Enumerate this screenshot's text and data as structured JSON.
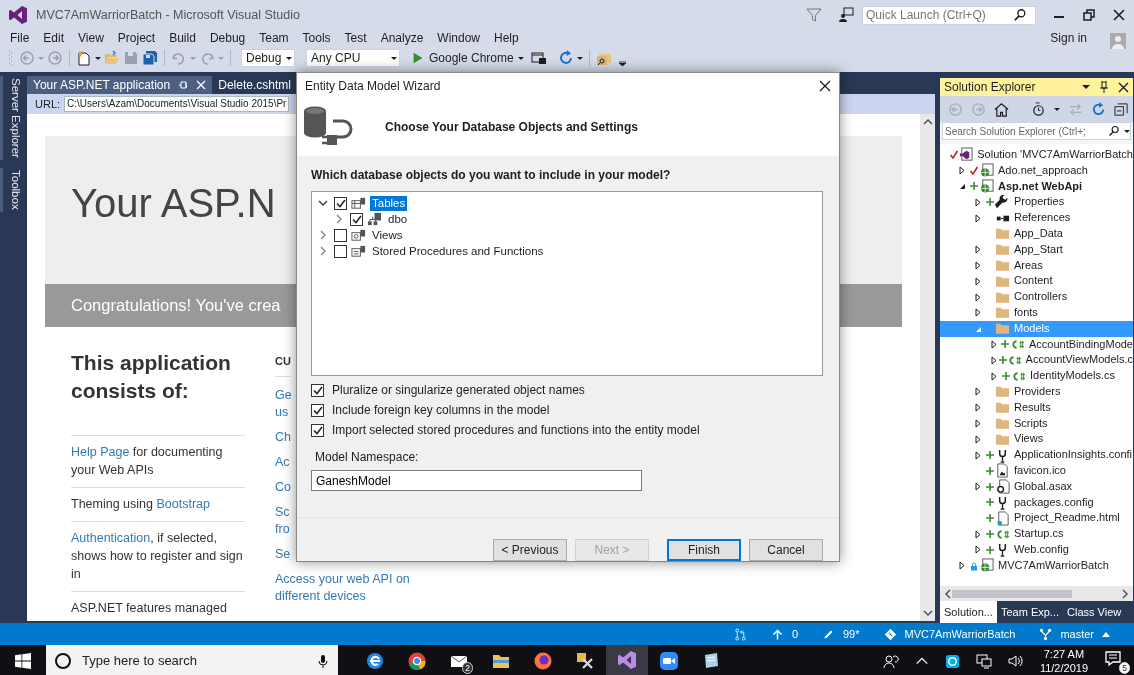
{
  "window": {
    "title": "MVC7AmWarriorBatch - Microsoft Visual Studio"
  },
  "quick_launch": {
    "placeholder": "Quick Launch (Ctrl+Q)"
  },
  "menu": [
    "File",
    "Edit",
    "View",
    "Project",
    "Build",
    "Debug",
    "Team",
    "Tools",
    "Test",
    "Analyze",
    "Window",
    "Help"
  ],
  "account": {
    "label": "Sign in"
  },
  "toolbar": {
    "configuration": "Debug",
    "platform": "Any CPU",
    "run_target": "Google Chrome"
  },
  "side_tabs": [
    "Server Explorer",
    "Toolbox"
  ],
  "document_tabs": [
    {
      "label": "Your ASP.NET application",
      "selected": true
    },
    {
      "label": "Delete.cshtml",
      "selected": false
    }
  ],
  "browser": {
    "url_label": "URL:",
    "url": "C:\\Users\\Azam\\Documents\\Visual Studio 2015\\Pr",
    "page": {
      "heading": "Your ASP.N",
      "banner": "Congratulations! You've crea",
      "section_heading": "This application consists of:",
      "features": [
        {
          "parts": [
            {
              "text": "Help Page",
              "link": true
            },
            {
              "text": " for documenting your Web APIs",
              "link": false
            }
          ]
        },
        {
          "parts": [
            {
              "text": "Theming using ",
              "link": false
            },
            {
              "text": "Bootstrap",
              "link": true
            }
          ]
        },
        {
          "parts": [
            {
              "text": "Authentication",
              "link": true
            },
            {
              "text": ", if selected, shows how to register and sign in",
              "link": false
            }
          ]
        },
        {
          "parts": [
            {
              "text": "ASP.NET features managed",
              "link": false
            }
          ]
        }
      ],
      "column_2": [
        {
          "kind": "heading",
          "lines": [
            "CU"
          ]
        },
        {
          "kind": "link",
          "lines": [
            "Ge",
            "us"
          ]
        },
        {
          "kind": "link",
          "lines": [
            "Ch"
          ]
        },
        {
          "kind": "link",
          "lines": [
            "Ac"
          ]
        },
        {
          "kind": "link",
          "lines": [
            "Co"
          ]
        },
        {
          "kind": "link",
          "lines": [
            "Sc",
            "fro"
          ]
        },
        {
          "kind": "link",
          "lines": [
            "Se"
          ]
        },
        {
          "kind": "link",
          "lines": [
            "Access your web API on different devices"
          ]
        }
      ]
    }
  },
  "dialog": {
    "title": "Entity Data Model Wizard",
    "heading": "Choose Your Database Objects and Settings",
    "question": "Which database objects do you want to include in your model?",
    "tree": [
      {
        "label": "Tables",
        "kind": "tables",
        "checked": true,
        "expanded": true,
        "selected": true,
        "children": [
          {
            "label": "dbo",
            "kind": "schema",
            "checked": true,
            "expanded": false,
            "selected": false
          }
        ]
      },
      {
        "label": "Views",
        "kind": "views",
        "checked": false,
        "expanded": false,
        "selected": false
      },
      {
        "label": "Stored Procedures and Functions",
        "kind": "procedures",
        "checked": false,
        "expanded": false,
        "selected": false
      }
    ],
    "options": [
      {
        "label": "Pluralize or singularize generated object names",
        "checked": true
      },
      {
        "label": "Include foreign key columns in the model",
        "checked": true
      },
      {
        "label": "Import selected stored procedures and functions into the entity model",
        "checked": true
      }
    ],
    "namespace_label": "Model Namespace:",
    "namespace": "GaneshModel",
    "buttons": [
      {
        "label": "< Previous",
        "disabled": false,
        "default": false
      },
      {
        "label": "Next >",
        "disabled": true,
        "default": false
      },
      {
        "label": "Finish",
        "disabled": false,
        "default": true
      },
      {
        "label": "Cancel",
        "disabled": false,
        "default": false
      }
    ]
  },
  "solution_explorer": {
    "title": "Solution Explorer",
    "search": {
      "placeholder": "Search Solution Explorer (Ctrl+;"
    },
    "tree": [
      {
        "label": "Solution 'MVC7AmWarriorBatch",
        "kind": "solution",
        "checked_in": true,
        "added": false,
        "bold": false,
        "selected": false,
        "children": [
          {
            "label": "Ado.net_approach",
            "kind": "project",
            "checked_in": true,
            "added": false,
            "bold": false,
            "selected": false,
            "expanded": false
          },
          {
            "label": "Asp.net WebApi",
            "kind": "project",
            "added": true,
            "bold": true,
            "selected": false,
            "expanded": true,
            "children": [
              {
                "label": "Properties",
                "kind": "wrench",
                "added": true,
                "bold": false,
                "selected": false,
                "expanded": false
              },
              {
                "label": "References",
                "kind": "references",
                "added": false,
                "bold": false,
                "selected": false,
                "expanded": false
              },
              {
                "label": "App_Data",
                "kind": "folder",
                "added": false,
                "bold": false,
                "selected": false
              },
              {
                "label": "App_Start",
                "kind": "folder",
                "added": false,
                "bold": false,
                "selected": false,
                "expanded": false
              },
              {
                "label": "Areas",
                "kind": "folder",
                "added": false,
                "bold": false,
                "selected": false,
                "expanded": false
              },
              {
                "label": "Content",
                "kind": "folder",
                "added": false,
                "bold": false,
                "selected": false,
                "expanded": false
              },
              {
                "label": "Controllers",
                "kind": "folder",
                "added": false,
                "bold": false,
                "selected": false,
                "expanded": false
              },
              {
                "label": "fonts",
                "kind": "folder",
                "added": false,
                "bold": false,
                "selected": false,
                "expanded": false
              },
              {
                "label": "Models",
                "kind": "folder",
                "added": false,
                "bold": false,
                "selected": true,
                "expanded": true,
                "children": [
                  {
                    "label": "AccountBindingMode",
                    "kind": "cs",
                    "added": true,
                    "bold": false,
                    "selected": false,
                    "expanded": false
                  },
                  {
                    "label": "AccountViewModels.c",
                    "kind": "cs",
                    "added": true,
                    "bold": false,
                    "selected": false,
                    "expanded": false
                  },
                  {
                    "label": "IdentityModels.cs",
                    "kind": "cs",
                    "added": true,
                    "bold": false,
                    "selected": false,
                    "expanded": false
                  }
                ]
              },
              {
                "label": "Providers",
                "kind": "folder",
                "added": false,
                "bold": false,
                "selected": false,
                "expanded": false
              },
              {
                "label": "Results",
                "kind": "folder",
                "added": false,
                "bold": false,
                "selected": false,
                "expanded": false
              },
              {
                "label": "Scripts",
                "kind": "folder",
                "added": false,
                "bold": false,
                "selected": false,
                "expanded": false
              },
              {
                "label": "Views",
                "kind": "folder",
                "added": false,
                "bold": false,
                "selected": false,
                "expanded": false
              },
              {
                "label": "ApplicationInsights.confi",
                "kind": "config",
                "added": true,
                "bold": false,
                "selected": false,
                "expanded": false
              },
              {
                "label": "favicon.ico",
                "kind": "image",
                "added": true,
                "bold": false,
                "selected": false
              },
              {
                "label": "Global.asax",
                "kind": "global",
                "added": true,
                "bold": false,
                "selected": false,
                "expanded": false
              },
              {
                "label": "packages.config",
                "kind": "config",
                "added": true,
                "bold": false,
                "selected": false
              },
              {
                "label": "Project_Readme.html",
                "kind": "html",
                "added": true,
                "bold": false,
                "selected": false
              },
              {
                "label": "Startup.cs",
                "kind": "cs",
                "added": true,
                "bold": false,
                "selected": false,
                "expanded": false
              },
              {
                "label": "Web.config",
                "kind": "config",
                "added": true,
                "bold": false,
                "selected": false,
                "expanded": false
              }
            ]
          },
          {
            "label": "MVC7AmWarriorBatch",
            "kind": "project",
            "locked": true,
            "added": false,
            "bold": false,
            "selected": false,
            "expanded": false
          }
        ]
      }
    ],
    "tabs": [
      {
        "label": "Solution...",
        "selected": true
      },
      {
        "label": "Team Exp...",
        "selected": false
      },
      {
        "label": "Class View",
        "selected": false
      }
    ]
  },
  "status_bar": [
    {
      "kind": "pull"
    },
    {
      "kind": "push",
      "text": "0"
    },
    {
      "kind": "edits",
      "text": "99*"
    },
    {
      "kind": "repo",
      "text": "MVC7AmWarriorBatch"
    },
    {
      "kind": "branch",
      "text": "master"
    }
  ],
  "taskbar": {
    "search": {
      "placeholder": "Type here to search"
    },
    "apps": [
      {
        "kind": "e-browser",
        "selected": false
      },
      {
        "kind": "round-browser",
        "selected": false
      },
      {
        "kind": "mail",
        "selected": false,
        "badge": "2"
      },
      {
        "kind": "folder",
        "selected": false
      },
      {
        "kind": "fox-browser",
        "selected": false
      },
      {
        "kind": "tools",
        "selected": false
      },
      {
        "kind": "ide",
        "selected": true
      },
      {
        "kind": "video",
        "selected": false
      },
      {
        "kind": "notes",
        "selected": false
      }
    ],
    "time": "7:27 AM",
    "date": "11/2/2019",
    "notifications": "5"
  }
}
